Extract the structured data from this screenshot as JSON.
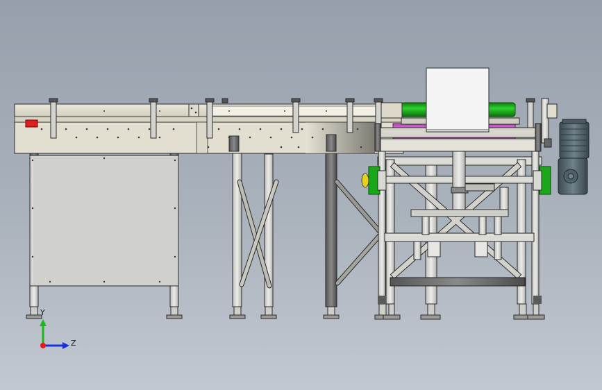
{
  "axis_triad": {
    "y_label": "Y",
    "z_label": "Z",
    "colors": {
      "y": "#18b818",
      "z": "#1830d8",
      "origin": "#e81818"
    }
  },
  "colors": {
    "frame": "#e4e0d2",
    "frame_dark": "#c9c5b6",
    "panel": "#cfd0cc",
    "leg": "#d6d6d0",
    "leg_dark": "#7f8180",
    "outline": "#2a2a2a",
    "green_roller": "#1aa81a",
    "pink_belt": "#e070e0",
    "motor": "#55656c",
    "red_stop": "#e02020",
    "yellow_bearing": "#e8d020",
    "hood": "#f4f4f4"
  },
  "components": [
    "conveyor-rail",
    "infeed-cabinet",
    "x-brace-stand",
    "metal-detector-hood",
    "reject-frame",
    "gear-motor",
    "adjustable-feet"
  ]
}
